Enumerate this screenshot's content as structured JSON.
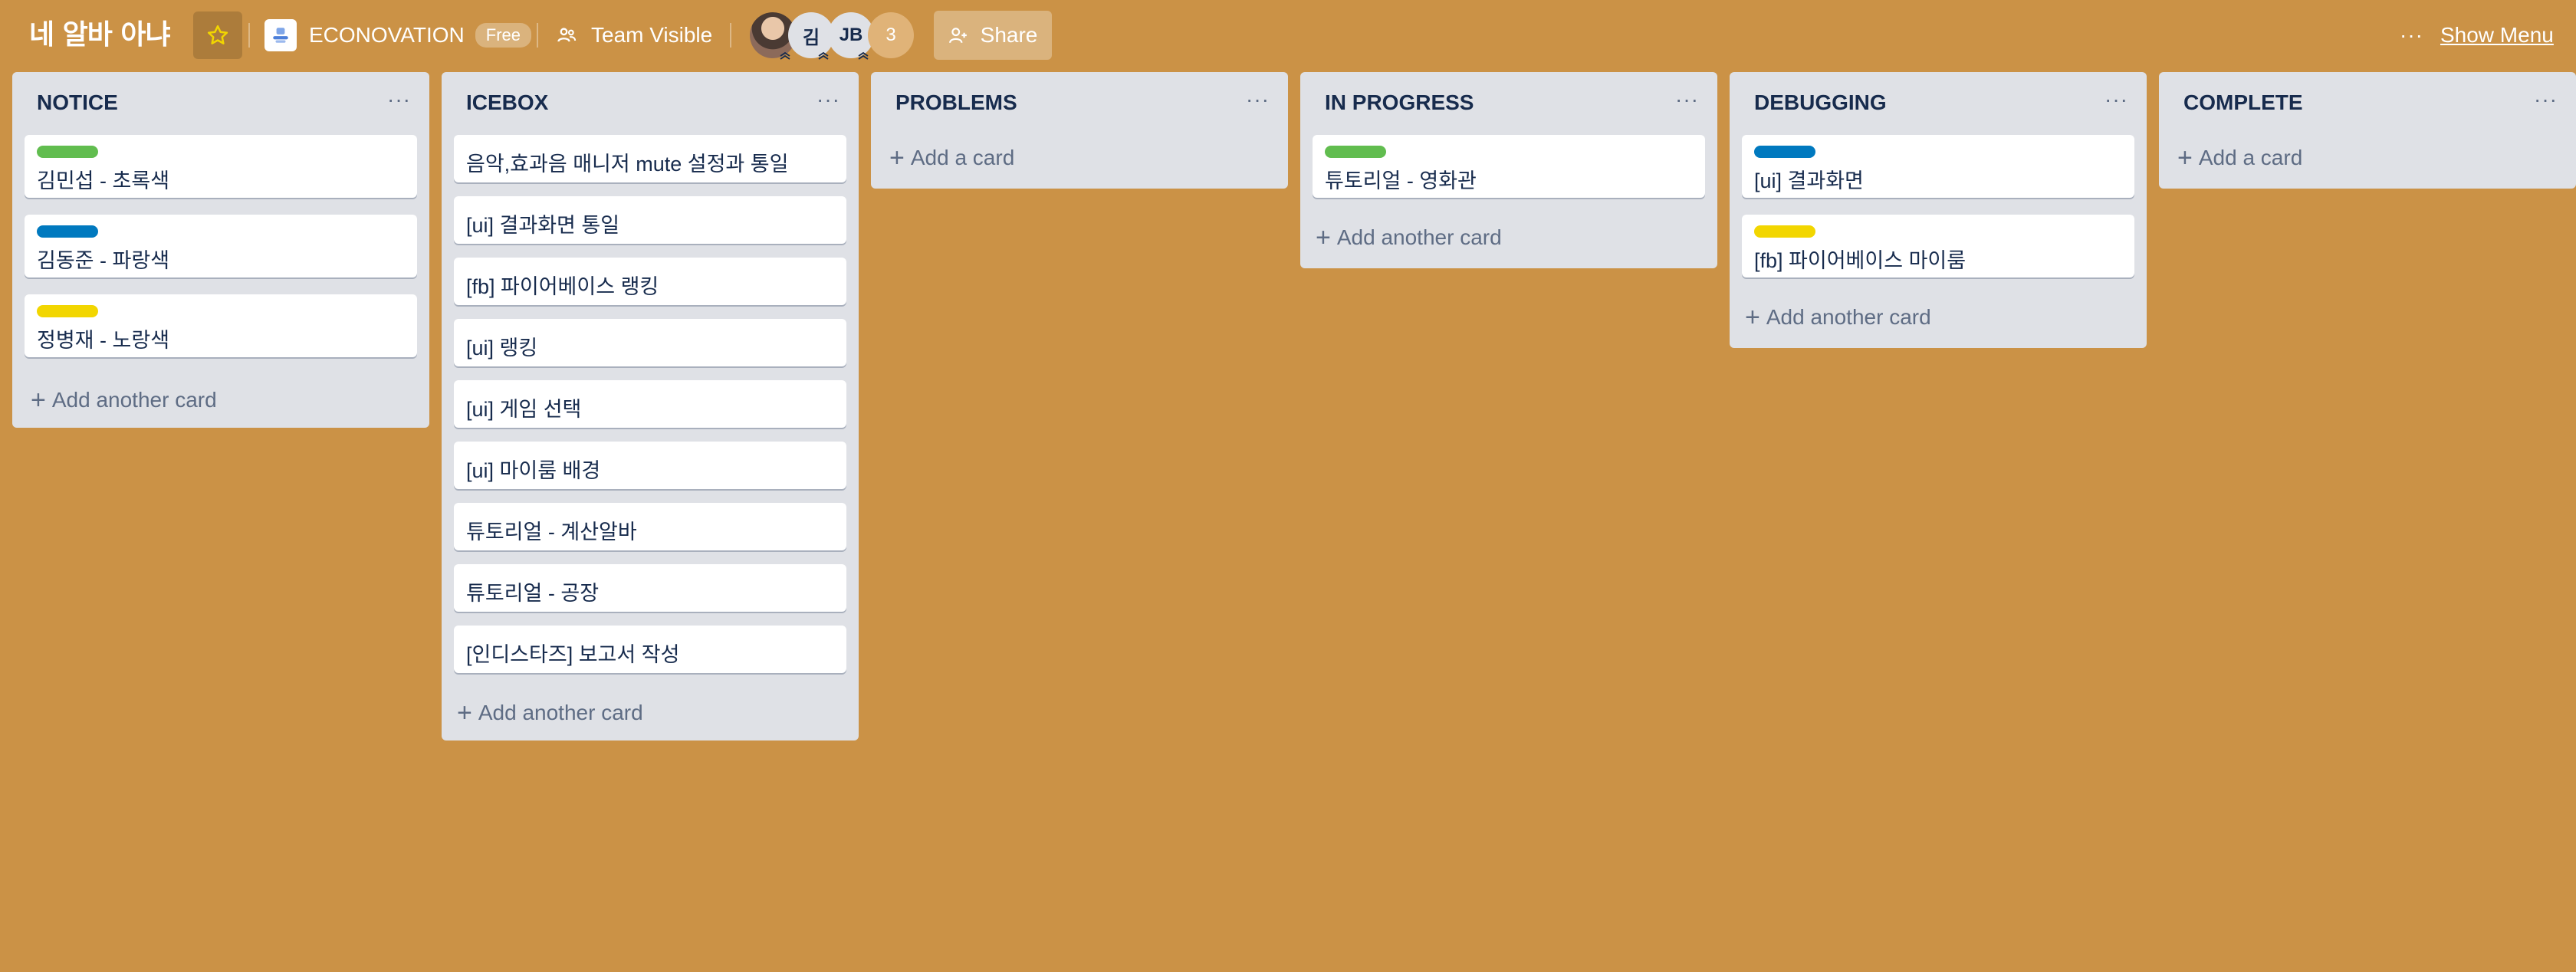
{
  "header": {
    "board_title": "네 알바 아냐",
    "workspace_name": "ECONOVATION",
    "workspace_badge": "Free",
    "visibility_label": "Team Visible",
    "members": [
      {
        "kind": "photo"
      },
      {
        "kind": "initial",
        "text": "김"
      },
      {
        "kind": "initial",
        "text": "JB"
      }
    ],
    "member_overflow": "3",
    "share_label": "Share",
    "menu_dots": "···",
    "show_menu_label": "Show Menu"
  },
  "colors": {
    "board_background": "#CB9246",
    "label_green": "#61BD4F",
    "label_blue": "#0079BF",
    "label_yellow": "#F2D600",
    "star": "#F2D600"
  },
  "lists": [
    {
      "title": "NOTICE",
      "menu": "···",
      "cards": [
        {
          "label": "green",
          "title": "김민섭 - 초록색"
        },
        {
          "label": "blue",
          "title": "김동준 - 파랑색"
        },
        {
          "label": "yellow",
          "title": "정병재 - 노랑색"
        }
      ],
      "add_label": "Add another card"
    },
    {
      "title": "ICEBOX",
      "menu": "···",
      "cards": [
        {
          "title": "음악,효과음 매니저 mute 설정과 통일"
        },
        {
          "title": "[ui] 결과화면 통일"
        },
        {
          "title": "[fb] 파이어베이스 랭킹"
        },
        {
          "title": "[ui] 랭킹"
        },
        {
          "title": "[ui] 게임 선택"
        },
        {
          "title": "[ui] 마이룸 배경"
        },
        {
          "title": "튜토리얼 - 계산알바"
        },
        {
          "title": "튜토리얼 - 공장"
        },
        {
          "title": "[인디스타즈] 보고서 작성"
        }
      ],
      "add_label": "Add another card"
    },
    {
      "title": "PROBLEMS",
      "menu": "···",
      "cards": [],
      "add_label": "Add a card"
    },
    {
      "title": "IN PROGRESS",
      "menu": "···",
      "cards": [
        {
          "label": "green",
          "title": "튜토리얼 - 영화관"
        }
      ],
      "add_label": "Add another card"
    },
    {
      "title": "DEBUGGING",
      "menu": "···",
      "cards": [
        {
          "label": "blue",
          "title": "[ui] 결과화면"
        },
        {
          "label": "yellow",
          "title": "[fb] 파이어베이스 마이룸"
        }
      ],
      "add_label": "Add another card"
    },
    {
      "title": "COMPLETE",
      "menu": "···",
      "cards": [],
      "add_label": "Add a card"
    }
  ]
}
